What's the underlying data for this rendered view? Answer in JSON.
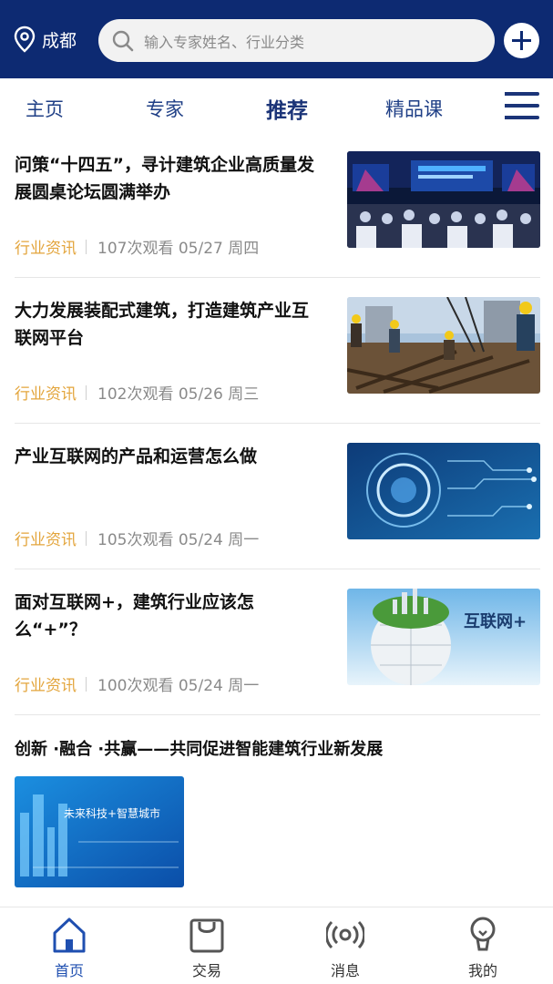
{
  "header": {
    "city": "成都",
    "search_placeholder": "输入专家姓名、行业分类"
  },
  "tabs": [
    "主页",
    "专家",
    "推荐",
    "精品课"
  ],
  "articles": [
    {
      "title": "问策“十四五”，寻计建筑企业高质量发展圆桌论坛圆满举办",
      "category": "行业资讯",
      "info": "107次观看 05/27 周四"
    },
    {
      "title": "大力发展装配式建筑，打造建筑产业互联网平台",
      "category": "行业资讯",
      "info": "102次观看 05/26 周三"
    },
    {
      "title": "产业互联网的产品和运营怎么做",
      "category": "行业资讯",
      "info": "105次观看 05/24 周一"
    },
    {
      "title": "面对互联网+，建筑行业应该怎么“+”？",
      "category": "行业资讯",
      "info": "100次观看 05/24 周一"
    }
  ],
  "featured": {
    "title": "创新 ·融合 ·共赢——共同促进智能建筑行业新发展",
    "image_text": "未来科技+智慧城市"
  },
  "image_texts": {
    "internet_plus": "互联网+"
  },
  "bottom_nav": [
    "首页",
    "交易",
    "消息",
    "我的"
  ],
  "colors": {
    "header_bg": "#0d2a72",
    "accent": "#1b3478",
    "category": "#e3a53c",
    "meta": "#8a8a8a"
  }
}
